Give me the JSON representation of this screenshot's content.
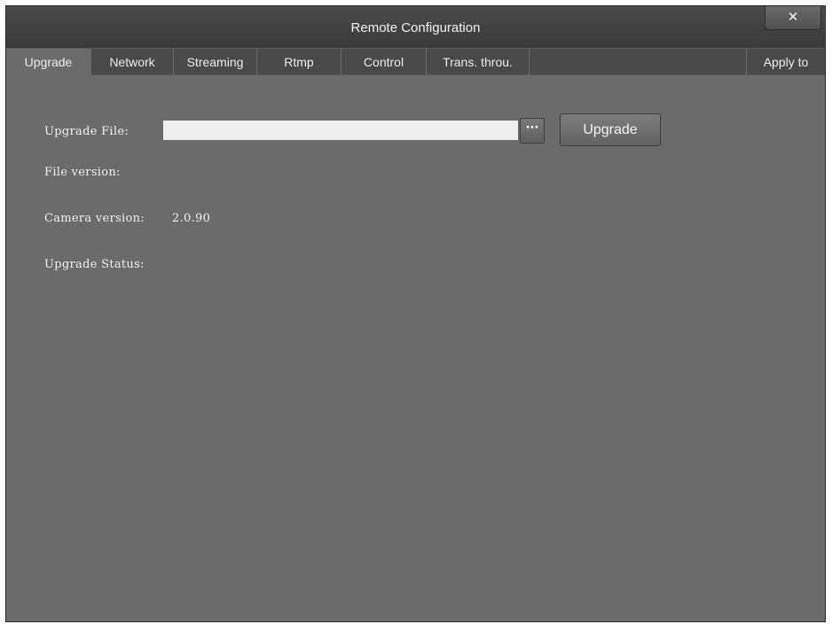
{
  "window": {
    "title": "Remote Configuration",
    "close_label": "✕"
  },
  "tabs": [
    {
      "label": "Upgrade"
    },
    {
      "label": "Network"
    },
    {
      "label": "Streaming"
    },
    {
      "label": "Rtmp"
    },
    {
      "label": "Control"
    },
    {
      "label": "Trans. throu."
    }
  ],
  "apply_label": "Apply to",
  "upgrade": {
    "file_label": "Upgrade File:",
    "file_value": "",
    "browse_label": "···",
    "upgrade_button": "Upgrade",
    "file_version_label": "File version:",
    "file_version_value": "",
    "camera_version_label": "Camera version:",
    "camera_version_value": "2.0.90",
    "status_label": "Upgrade Status:",
    "status_value": ""
  }
}
